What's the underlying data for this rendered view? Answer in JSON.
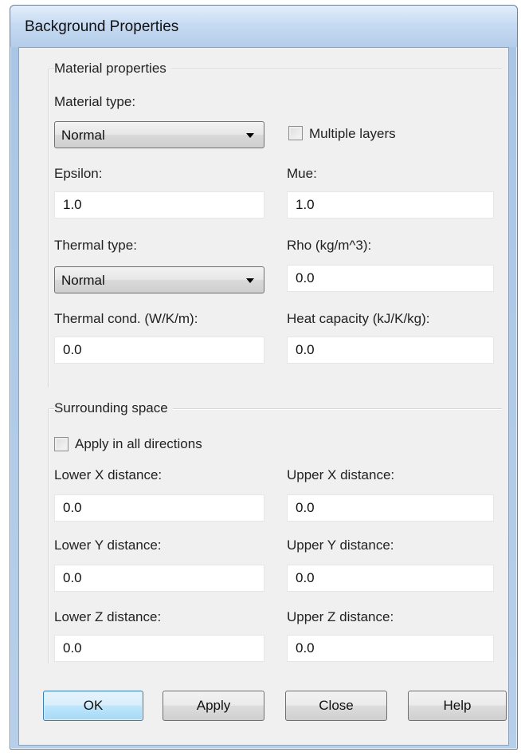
{
  "window": {
    "title": "Background Properties"
  },
  "material": {
    "group_title": "Material properties",
    "material_type_label": "Material type:",
    "material_type_value": "Normal",
    "multiple_layers_label": "Multiple layers",
    "multiple_layers_checked": false,
    "epsilon_label": "Epsilon:",
    "epsilon_value": "1.0",
    "mue_label": "Mue:",
    "mue_value": "1.0",
    "thermal_type_label": "Thermal type:",
    "thermal_type_value": "Normal",
    "rho_label": "Rho (kg/m^3):",
    "rho_value": "0.0",
    "thermal_cond_label": "Thermal cond. (W/K/m):",
    "thermal_cond_value": "0.0",
    "heat_capacity_label": "Heat capacity (kJ/K/kg):",
    "heat_capacity_value": "0.0"
  },
  "surrounding": {
    "group_title": "Surrounding space",
    "apply_all_label": "Apply in all directions",
    "apply_all_checked": false,
    "lower_x_label": "Lower X distance:",
    "lower_x_value": "0.0",
    "upper_x_label": "Upper X distance:",
    "upper_x_value": "0.0",
    "lower_y_label": "Lower Y distance:",
    "lower_y_value": "0.0",
    "upper_y_label": "Upper Y distance:",
    "upper_y_value": "0.0",
    "lower_z_label": "Lower Z distance:",
    "lower_z_value": "0.0",
    "upper_z_label": "Upper Z distance:",
    "upper_z_value": "0.0"
  },
  "buttons": {
    "ok": "OK",
    "apply": "Apply",
    "close": "Close",
    "help": "Help"
  },
  "colors": {
    "titlebar": "#c6dbf3",
    "client_bg": "#f0f0f0",
    "default_button": "#bee6fd"
  }
}
